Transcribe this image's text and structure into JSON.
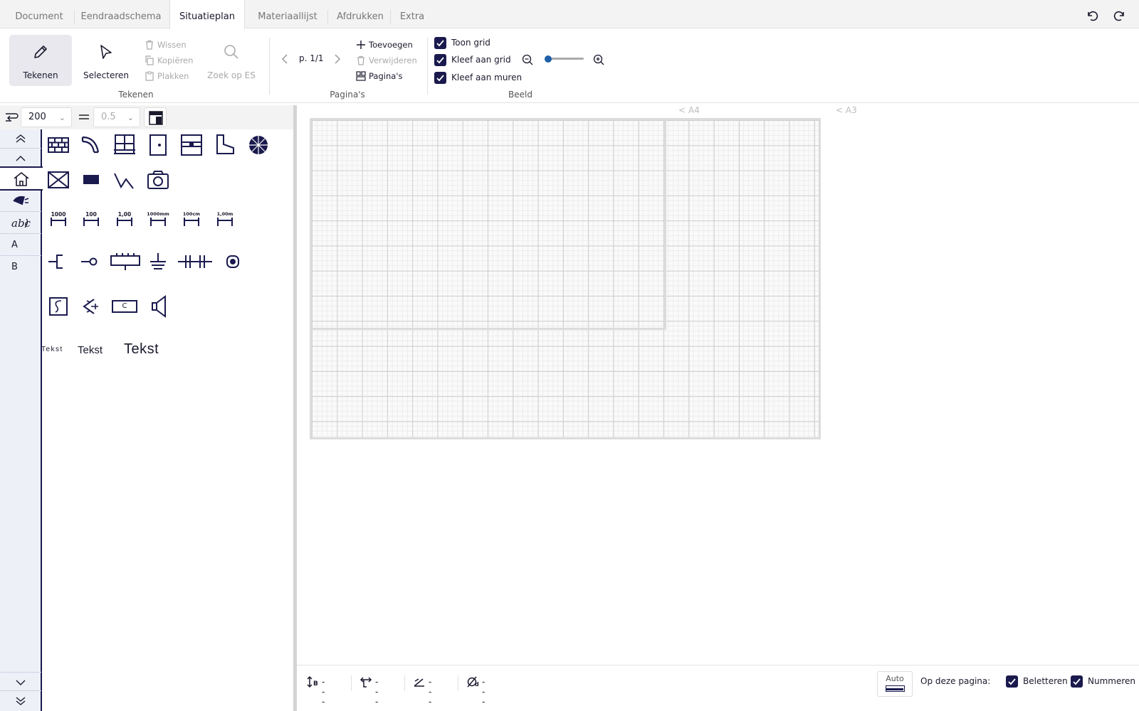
{
  "tabs": [
    {
      "label": "Document",
      "active": false
    },
    {
      "label": "Eendraadschema",
      "active": false
    },
    {
      "label": "Situatieplan",
      "active": true
    },
    {
      "label": "Materiaallijst",
      "active": false
    },
    {
      "label": "Afdrukken",
      "active": false
    },
    {
      "label": "Extra",
      "active": false
    }
  ],
  "history": {
    "undo_icon": "undo-icon",
    "redo_icon": "redo-icon"
  },
  "ribbon": {
    "tekenen": {
      "draw_label": "Tekenen",
      "select_label": "Selecteren",
      "delete_label": "Wissen",
      "copy_label": "Kopiëren",
      "paste_label": "Plakken",
      "search_label": "Zoek op ES",
      "group_label": "Tekenen"
    },
    "paginas": {
      "page_label": "p. 1/1",
      "add_label": "Toevoegen",
      "remove_label": "Verwijderen",
      "pages_label": "Pagina's",
      "group_label": "Pagina's"
    },
    "beeld": {
      "show_grid": "Toon grid",
      "snap_grid": "Kleef aan grid",
      "snap_walls": "Kleef aan muren",
      "zoom_level": 0.05,
      "group_label": "Beeld"
    }
  },
  "toolbar": {
    "scale_value": "200",
    "line_width": "0.5"
  },
  "categories": {
    "a_label": "A",
    "b_label": "B"
  },
  "palette": {
    "scale_labels": [
      "1000",
      "100",
      "1,00",
      "1000mm",
      "100cm",
      "1,00m"
    ],
    "text_small": "Tekst",
    "text_medium": "Tekst",
    "text_large": "Tekst",
    "symbol_c": "C"
  },
  "canvas": {
    "a4_label": "< A4",
    "a3_label": "< A3"
  },
  "status": {
    "height_value": "---",
    "offset_value": "---",
    "angle_value": "---",
    "diameter_value": "---",
    "auto_label": "Auto",
    "this_page_label": "Op deze pagina:",
    "label_check": "Beletteren",
    "number_check": "Nummeren"
  },
  "colors": {
    "accent": "#1a1a4e",
    "slider_dot": "#1f5fa8"
  }
}
